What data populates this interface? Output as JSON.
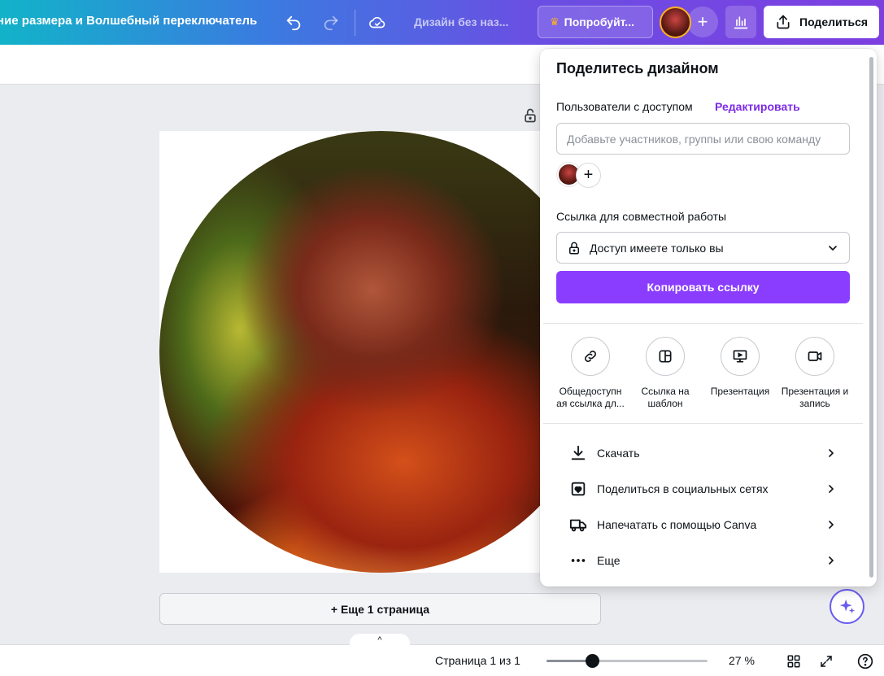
{
  "topbar": {
    "title": "ние размера и Волшебный переключатель",
    "design_name": "Дизайн без наз...",
    "try_label": "Попробуйт...",
    "share_label": "Поделиться",
    "add_label": "+"
  },
  "canvas": {
    "more_page_label": "+ Еще 1 страница"
  },
  "share_panel": {
    "title": "Поделитесь дизайном",
    "users_label": "Пользователи с доступом",
    "edit_link": "Редактировать",
    "people_placeholder": "Добавьте участников, группы или свою команду",
    "add_label": "+",
    "collab_label": "Ссылка для совместной работы",
    "access_value": "Доступ имеете только вы",
    "copy_button": "Копировать ссылку",
    "options": [
      {
        "label": "Общедоступн ая ссылка дл...",
        "icon": "link-icon"
      },
      {
        "label": "Ссылка на шаблон",
        "icon": "template-icon"
      },
      {
        "label": "Презентация",
        "icon": "presentation-icon"
      },
      {
        "label": "Презентация и запись",
        "icon": "video-icon"
      }
    ],
    "menu": [
      {
        "label": "Скачать",
        "icon": "download-icon"
      },
      {
        "label": "Поделиться в социальных сетях",
        "icon": "heart-icon"
      },
      {
        "label": "Напечатать с помощью Canva",
        "icon": "truck-icon"
      },
      {
        "label": "Еще",
        "icon": "more-icon"
      }
    ]
  },
  "bottombar": {
    "collapse_label": "^",
    "page_count": "Страница 1 из 1",
    "zoom": "27 %",
    "zoom_percent": 27
  },
  "colors": {
    "accent": "#8b3dff",
    "link": "#7d2ae8",
    "crown": "#ffb020"
  }
}
